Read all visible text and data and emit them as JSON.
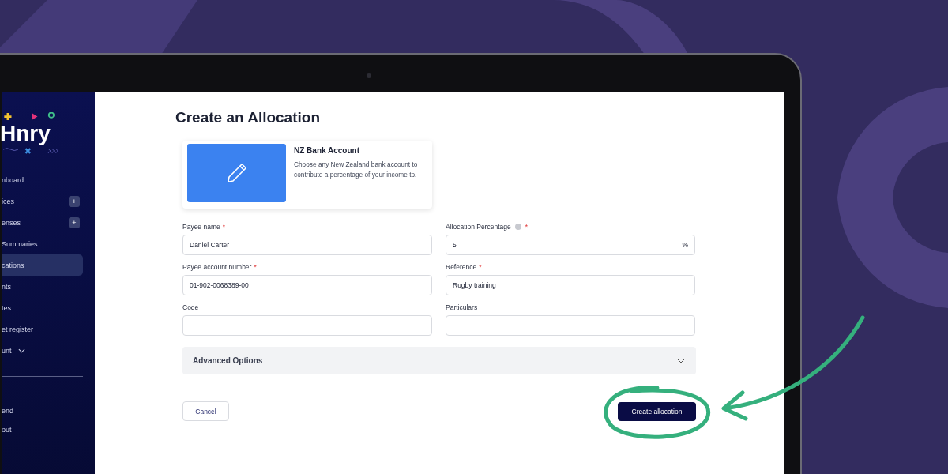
{
  "sidebar": {
    "logo": "Hnry",
    "items": [
      {
        "label": "nboard",
        "kind": "plain",
        "selected": false
      },
      {
        "label": "ices",
        "kind": "add",
        "add": "+",
        "selected": false
      },
      {
        "label": "enses",
        "kind": "add",
        "add": "+",
        "selected": false
      },
      {
        "label": "Summaries",
        "kind": "plain",
        "selected": false
      },
      {
        "label": "cations",
        "kind": "plain",
        "selected": true
      },
      {
        "label": "nts",
        "kind": "plain",
        "selected": false
      },
      {
        "label": "tes",
        "kind": "plain",
        "selected": false
      },
      {
        "label": "et register",
        "kind": "plain",
        "selected": false
      },
      {
        "label": "unt",
        "kind": "dropdown",
        "selected": false
      }
    ],
    "footer_items": [
      {
        "label": "end"
      },
      {
        "label": "out"
      }
    ]
  },
  "page": {
    "title": "Create an Allocation",
    "option_card": {
      "title": "NZ Bank Account",
      "description": "Choose any New Zealand bank account to contribute a percentage of your income to."
    },
    "fields": [
      {
        "label": "Payee name",
        "required_mark": "*",
        "value": "Daniel Carter"
      },
      {
        "label": "Allocation Percentage",
        "help": true,
        "required_mark": "*",
        "value": "5",
        "suffix": "%"
      },
      {
        "label": "Payee account number",
        "required_mark": "*",
        "value": "01-902-0068389-00"
      },
      {
        "label": "Reference",
        "required_mark": "*",
        "value": "Rugby training"
      },
      {
        "label": "Code"
      },
      {
        "label": "Particulars"
      }
    ],
    "advanced": {
      "label": "Advanced Options",
      "expanded": false
    },
    "buttons": {
      "cancel": "Cancel",
      "submit": "Create allocation"
    }
  }
}
